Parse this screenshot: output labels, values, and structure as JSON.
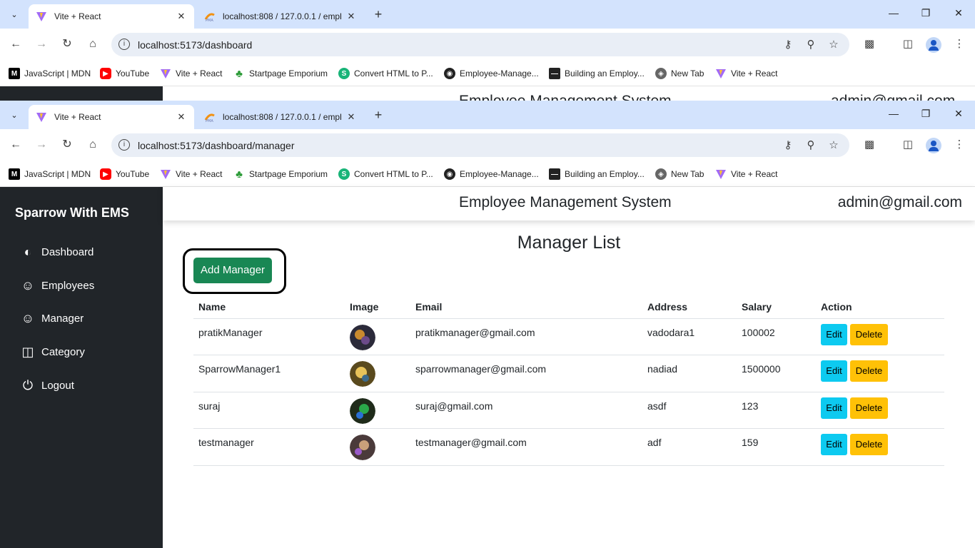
{
  "back_window": {
    "tabs": [
      {
        "title": "Vite + React",
        "active": true
      },
      {
        "title": "localhost:808 / 127.0.0.1 / empl",
        "active": false
      }
    ],
    "url": "localhost:5173/dashboard",
    "peek_title": "Employee Management System",
    "peek_email": "admin@gmail.com"
  },
  "front_window": {
    "tabs": [
      {
        "title": "Vite + React",
        "active": true
      },
      {
        "title": "localhost:808 / 127.0.0.1 / empl",
        "active": false
      }
    ],
    "url": "localhost:5173/dashboard/manager"
  },
  "bookmarks": [
    {
      "label": "JavaScript | MDN",
      "icon": "mdn-icon"
    },
    {
      "label": "YouTube",
      "icon": "youtube-icon"
    },
    {
      "label": "Vite + React",
      "icon": "vite-icon"
    },
    {
      "label": "Startpage Emporium",
      "icon": "clover-icon"
    },
    {
      "label": "Convert HTML to P...",
      "icon": "convert-icon"
    },
    {
      "label": "Employee-Manage...",
      "icon": "github-icon"
    },
    {
      "label": "Building an Employ...",
      "icon": "dev-icon"
    },
    {
      "label": "New Tab",
      "icon": "globe-icon"
    },
    {
      "label": "Vite + React",
      "icon": "vite-icon"
    }
  ],
  "sidebar": {
    "brand": "Sparrow With EMS",
    "items": [
      {
        "label": "Dashboard",
        "icon": "speedometer-icon"
      },
      {
        "label": "Employees",
        "icon": "people-icon"
      },
      {
        "label": "Manager",
        "icon": "people-icon"
      },
      {
        "label": "Category",
        "icon": "columns-icon"
      },
      {
        "label": "Logout",
        "icon": "power-icon"
      }
    ]
  },
  "header": {
    "title": "Employee Management System",
    "email": "admin@gmail.com"
  },
  "main": {
    "page_title": "Manager List",
    "add_button": "Add Manager",
    "columns": [
      "Name",
      "Image",
      "Email",
      "Address",
      "Salary",
      "Action"
    ],
    "edit_label": "Edit",
    "delete_label": "Delete",
    "rows": [
      {
        "name": "pratikManager",
        "email": "pratikmanager@gmail.com",
        "address": "vadodara1",
        "salary": "100002"
      },
      {
        "name": "SparrowManager1",
        "email": "sparrowmanager@gmail.com",
        "address": "nadiad",
        "salary": "1500000"
      },
      {
        "name": "suraj",
        "email": "suraj@gmail.com",
        "address": "asdf",
        "salary": "123"
      },
      {
        "name": "testmanager",
        "email": "testmanager@gmail.com",
        "address": "adf",
        "salary": "159"
      }
    ]
  },
  "colors": {
    "sidebar_bg": "#212529",
    "tabstrip_bg": "#d3e3fd",
    "add_button": "#198754",
    "edit_button": "#0dcaf0",
    "delete_button": "#ffc107"
  }
}
